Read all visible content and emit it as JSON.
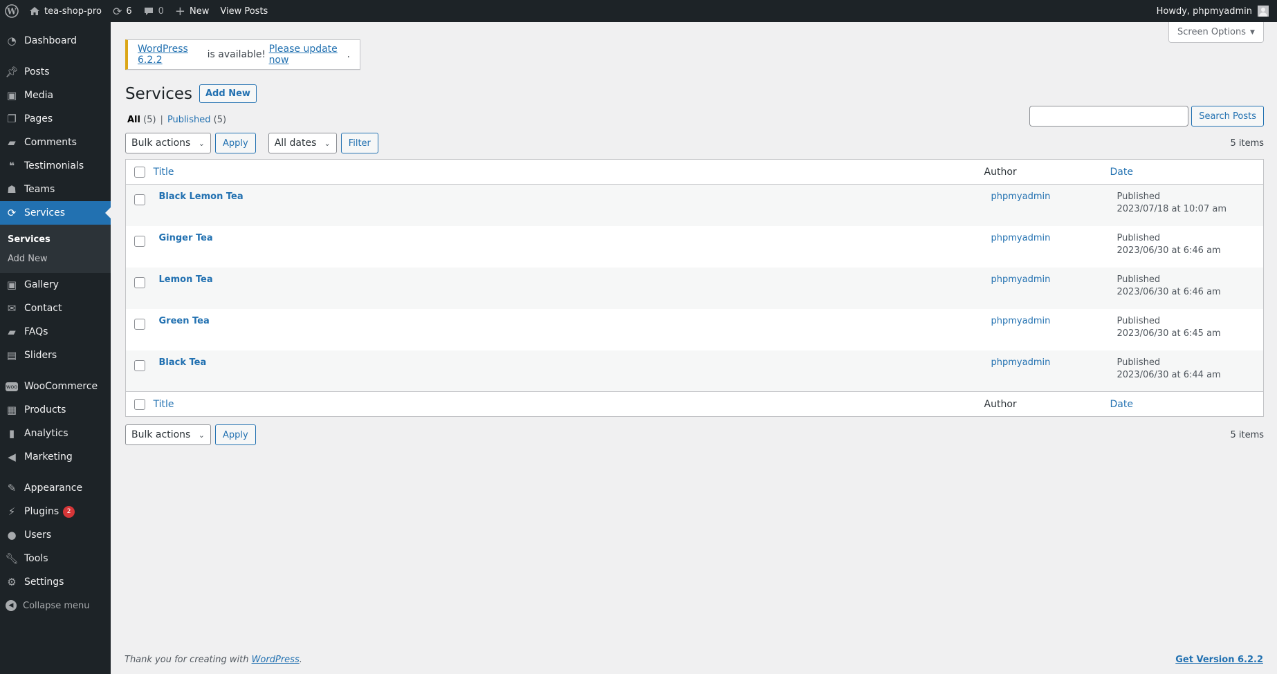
{
  "adminbar": {
    "site_name": "tea-shop-pro",
    "updates_count": "6",
    "comments_count": "0",
    "new_label": "New",
    "view_posts_label": "View Posts",
    "howdy": "Howdy, phpmyadmin"
  },
  "sidebar": {
    "items": [
      {
        "label": "Dashboard",
        "icon": "dashboard-icon"
      },
      {
        "label": "Posts",
        "icon": "pin-icon"
      },
      {
        "label": "Media",
        "icon": "media-icon"
      },
      {
        "label": "Pages",
        "icon": "pages-icon"
      },
      {
        "label": "Comments",
        "icon": "comment-icon"
      },
      {
        "label": "Testimonials",
        "icon": "testimonial-icon"
      },
      {
        "label": "Teams",
        "icon": "groups-icon"
      },
      {
        "label": "Services",
        "icon": "update-icon"
      },
      {
        "label": "Gallery",
        "icon": "gallery-icon"
      },
      {
        "label": "Contact",
        "icon": "email-icon"
      },
      {
        "label": "FAQs",
        "icon": "chat-icon"
      },
      {
        "label": "Sliders",
        "icon": "slides-icon"
      },
      {
        "label": "WooCommerce",
        "icon": "woo-icon"
      },
      {
        "label": "Products",
        "icon": "archive-icon"
      },
      {
        "label": "Analytics",
        "icon": "chart-icon"
      },
      {
        "label": "Marketing",
        "icon": "megaphone-icon"
      },
      {
        "label": "Appearance",
        "icon": "brush-icon"
      },
      {
        "label": "Plugins",
        "icon": "plugin-icon",
        "badge": "2"
      },
      {
        "label": "Users",
        "icon": "user-icon"
      },
      {
        "label": "Tools",
        "icon": "wrench-icon"
      },
      {
        "label": "Settings",
        "icon": "settings-icon"
      }
    ],
    "submenu": [
      "Services",
      "Add New"
    ],
    "collapse_label": "Collapse menu"
  },
  "screen_options_label": "Screen Options",
  "notice": {
    "version_link": "WordPress 6.2.2",
    "middle_text": " is available! ",
    "update_link": "Please update now",
    "end": "."
  },
  "page": {
    "title": "Services",
    "add_new_label": "Add New"
  },
  "filters": {
    "all_label": "All",
    "all_count": "(5)",
    "separator": "|",
    "published_label": "Published",
    "published_count": "(5)"
  },
  "search": {
    "value": "",
    "button_label": "Search Posts"
  },
  "tablenav": {
    "bulk_actions": "Bulk actions",
    "apply_label": "Apply",
    "dates": "All dates",
    "filter_label": "Filter",
    "items_count": "5 items"
  },
  "table": {
    "columns": {
      "title": "Title",
      "author": "Author",
      "date": "Date"
    },
    "rows": [
      {
        "title": "Black Lemon Tea",
        "author": "phpmyadmin",
        "status": "Published",
        "date": "2023/07/18 at 10:07 am"
      },
      {
        "title": "Ginger Tea",
        "author": "phpmyadmin",
        "status": "Published",
        "date": "2023/06/30 at 6:46 am"
      },
      {
        "title": "Lemon Tea",
        "author": "phpmyadmin",
        "status": "Published",
        "date": "2023/06/30 at 6:46 am"
      },
      {
        "title": "Green Tea",
        "author": "phpmyadmin",
        "status": "Published",
        "date": "2023/06/30 at 6:45 am"
      },
      {
        "title": "Black Tea",
        "author": "phpmyadmin",
        "status": "Published",
        "date": "2023/06/30 at 6:44 am"
      }
    ]
  },
  "footer": {
    "thanks_prefix": "Thank you for creating with ",
    "thanks_link": "WordPress",
    "thanks_suffix": ".",
    "version_link": "Get Version 6.2.2"
  },
  "colors": {
    "accent": "#2271b1",
    "adminbar_bg": "#1d2327",
    "notice_warning": "#dba617",
    "badge": "#d63638"
  }
}
